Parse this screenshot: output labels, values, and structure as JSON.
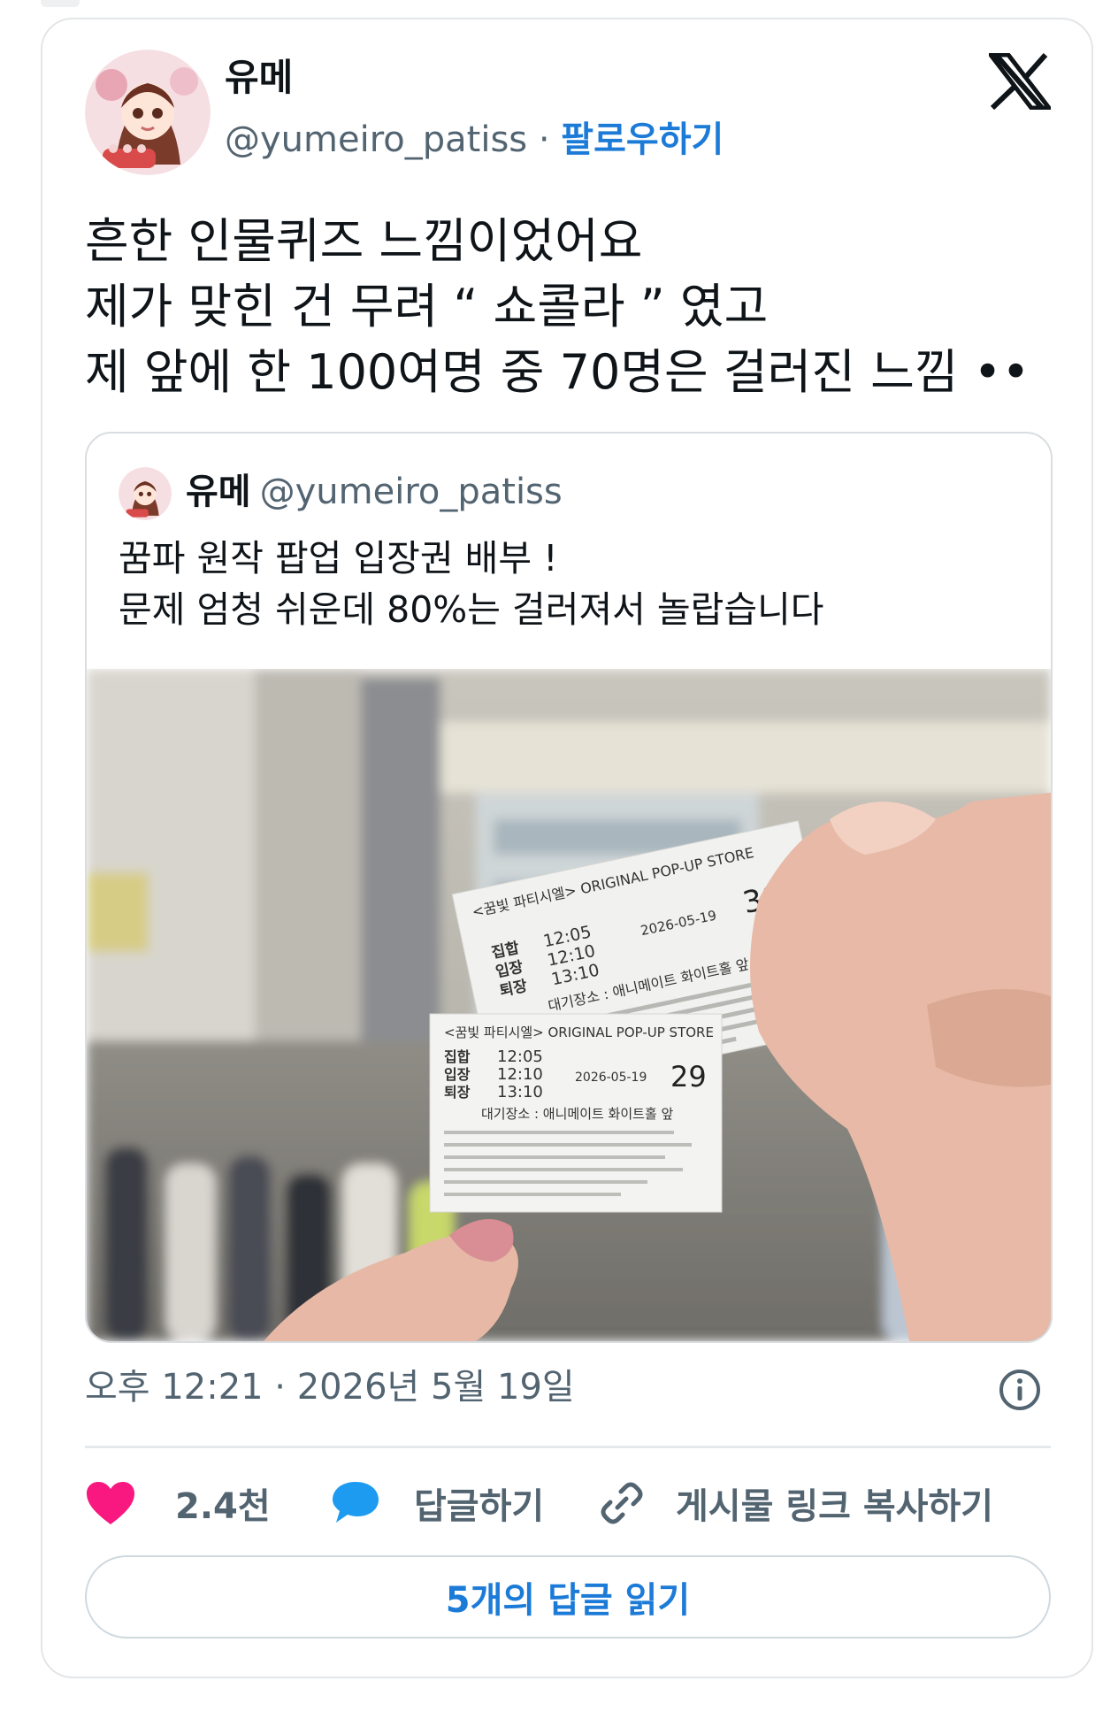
{
  "author": {
    "name": "유메",
    "handle": "@yumeiro_patiss",
    "separator": "·",
    "follow_label": "팔로우하기"
  },
  "tweet": {
    "text": "흔한 인물퀴즈 느낌이었어요\n제가 맞힌 건 무려 “ 쇼콜라 ” 였고\n제 앞에 한 100여명 중 70명은 걸러진 느낌 ••"
  },
  "quoted_tweet": {
    "name": "유메",
    "handle": "@yumeiro_patiss",
    "text": "꿈파 원작 팝업 입장권 배부 !\n문제 엄청 쉬운데 80%는 걸러져서 놀랍습니다",
    "photo": {
      "ticket_top": {
        "header": "<꿈빛 파티시엘> ORIGINAL POP-UP STORE",
        "date": "2026-05-19",
        "number": "30",
        "row1_label": "집합",
        "row1_time": "12:05",
        "row2_label": "입장",
        "row2_time": "12:10",
        "row3_label": "퇴장",
        "row3_time": "13:10",
        "waiting": "대기장소 : 애니메이트 화이트홀 앞"
      },
      "ticket_bottom": {
        "header": "<꿈빛 파티시엘> ORIGINAL POP-UP STORE",
        "date": "2026-05-19",
        "number": "29",
        "row1_label": "집합",
        "row1_time": "12:05",
        "row2_label": "입장",
        "row2_time": "12:10",
        "row3_label": "퇴장",
        "row3_time": "13:10",
        "waiting": "대기장소 : 애니메이트 화이트홀 앞"
      }
    }
  },
  "timestamp": "오후 12:21 · 2026년 5월 19일",
  "actions": {
    "likes_count": "2.4천",
    "reply_label": "답글하기",
    "copy_link_label": "게시물 링크 복사하기"
  },
  "read_replies_label": "5개의 답글 읽기",
  "colors": {
    "accent": "#1d7bd8",
    "like": "#f91880",
    "reply_icon": "#1d9bf0",
    "muted": "#536471"
  },
  "icons": {
    "brand": "x-logo-icon",
    "info": "info-icon",
    "like": "heart-icon",
    "reply": "speech-bubble-icon",
    "copy_link": "link-icon"
  }
}
